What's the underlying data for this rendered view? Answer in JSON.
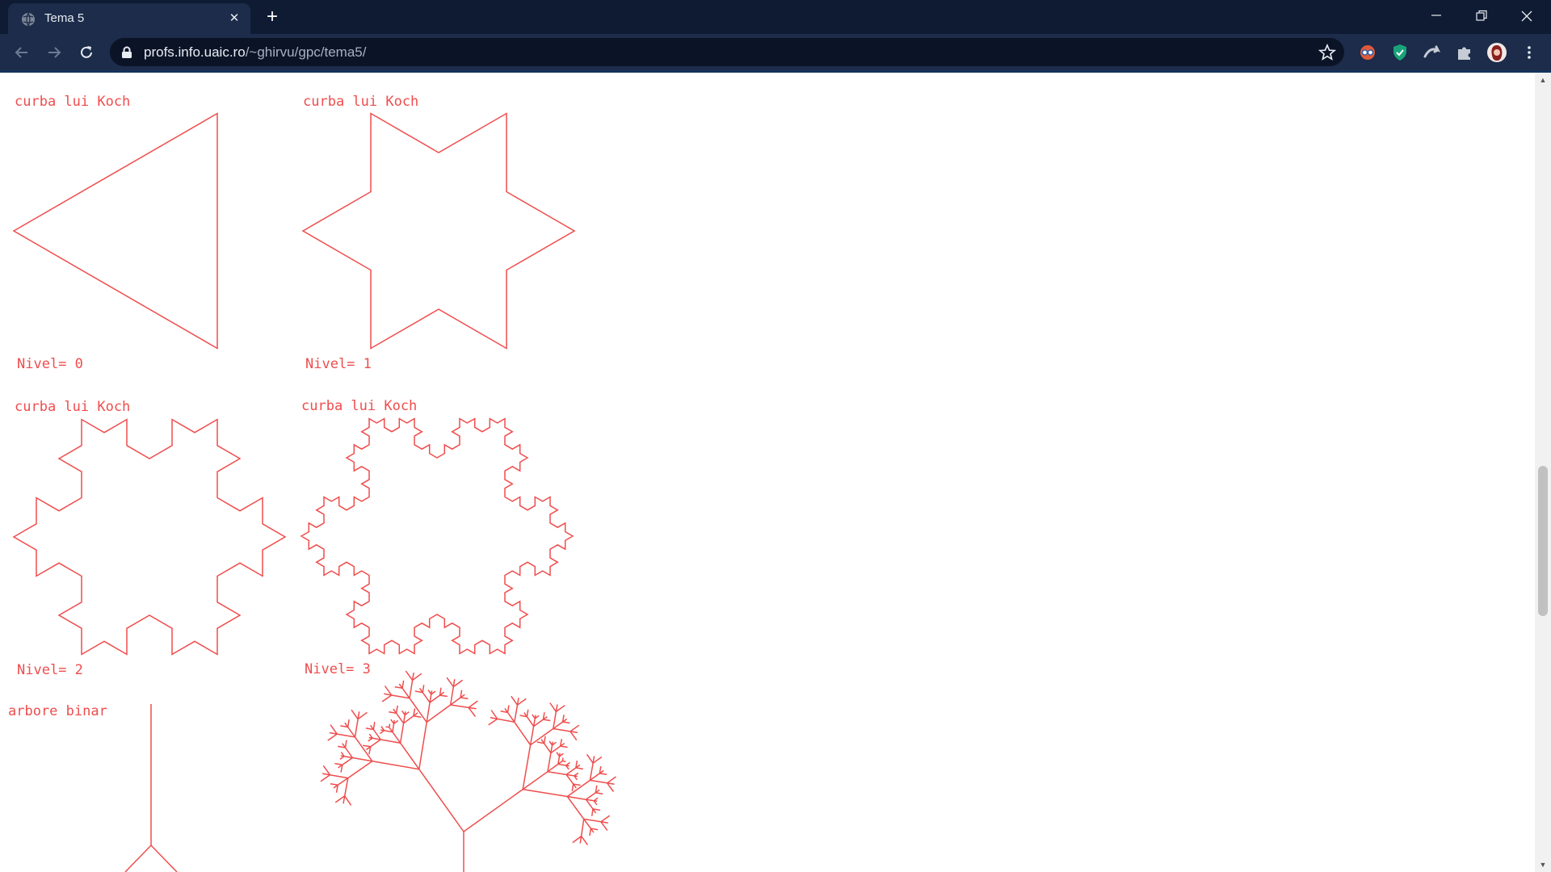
{
  "browser": {
    "tab_title": "Tema 5",
    "tab_close": "✕",
    "new_tab": "+",
    "url_host": "profs.info.uaic.ro",
    "url_path": "/~ghirvu/gpc/tema5/"
  },
  "page": {
    "koch_title": "curba lui Koch",
    "tree_title": "arbore binar",
    "levels": [
      "Nivel= 0",
      "Nivel= 1",
      "Nivel= 2",
      "Nivel= 3"
    ],
    "stroke_color": "#ef4d4d"
  }
}
